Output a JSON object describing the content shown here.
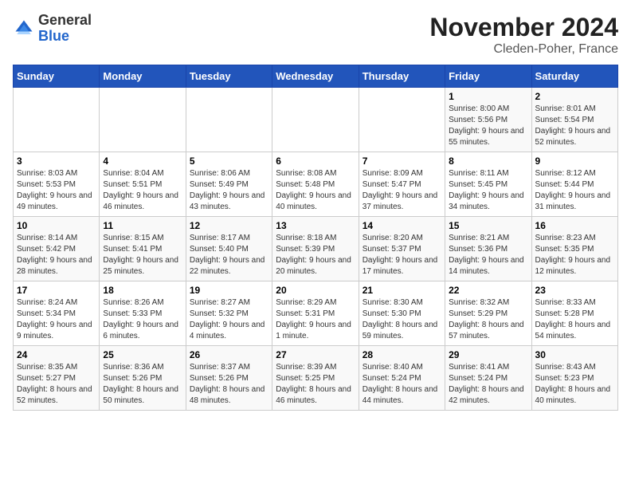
{
  "header": {
    "logo_line1": "General",
    "logo_line2": "Blue",
    "title": "November 2024",
    "subtitle": "Cleden-Poher, France"
  },
  "calendar": {
    "weekdays": [
      "Sunday",
      "Monday",
      "Tuesday",
      "Wednesday",
      "Thursday",
      "Friday",
      "Saturday"
    ],
    "weeks": [
      [
        {
          "day": "",
          "info": ""
        },
        {
          "day": "",
          "info": ""
        },
        {
          "day": "",
          "info": ""
        },
        {
          "day": "",
          "info": ""
        },
        {
          "day": "",
          "info": ""
        },
        {
          "day": "1",
          "info": "Sunrise: 8:00 AM\nSunset: 5:56 PM\nDaylight: 9 hours and 55 minutes."
        },
        {
          "day": "2",
          "info": "Sunrise: 8:01 AM\nSunset: 5:54 PM\nDaylight: 9 hours and 52 minutes."
        }
      ],
      [
        {
          "day": "3",
          "info": "Sunrise: 8:03 AM\nSunset: 5:53 PM\nDaylight: 9 hours and 49 minutes."
        },
        {
          "day": "4",
          "info": "Sunrise: 8:04 AM\nSunset: 5:51 PM\nDaylight: 9 hours and 46 minutes."
        },
        {
          "day": "5",
          "info": "Sunrise: 8:06 AM\nSunset: 5:49 PM\nDaylight: 9 hours and 43 minutes."
        },
        {
          "day": "6",
          "info": "Sunrise: 8:08 AM\nSunset: 5:48 PM\nDaylight: 9 hours and 40 minutes."
        },
        {
          "day": "7",
          "info": "Sunrise: 8:09 AM\nSunset: 5:47 PM\nDaylight: 9 hours and 37 minutes."
        },
        {
          "day": "8",
          "info": "Sunrise: 8:11 AM\nSunset: 5:45 PM\nDaylight: 9 hours and 34 minutes."
        },
        {
          "day": "9",
          "info": "Sunrise: 8:12 AM\nSunset: 5:44 PM\nDaylight: 9 hours and 31 minutes."
        }
      ],
      [
        {
          "day": "10",
          "info": "Sunrise: 8:14 AM\nSunset: 5:42 PM\nDaylight: 9 hours and 28 minutes."
        },
        {
          "day": "11",
          "info": "Sunrise: 8:15 AM\nSunset: 5:41 PM\nDaylight: 9 hours and 25 minutes."
        },
        {
          "day": "12",
          "info": "Sunrise: 8:17 AM\nSunset: 5:40 PM\nDaylight: 9 hours and 22 minutes."
        },
        {
          "day": "13",
          "info": "Sunrise: 8:18 AM\nSunset: 5:39 PM\nDaylight: 9 hours and 20 minutes."
        },
        {
          "day": "14",
          "info": "Sunrise: 8:20 AM\nSunset: 5:37 PM\nDaylight: 9 hours and 17 minutes."
        },
        {
          "day": "15",
          "info": "Sunrise: 8:21 AM\nSunset: 5:36 PM\nDaylight: 9 hours and 14 minutes."
        },
        {
          "day": "16",
          "info": "Sunrise: 8:23 AM\nSunset: 5:35 PM\nDaylight: 9 hours and 12 minutes."
        }
      ],
      [
        {
          "day": "17",
          "info": "Sunrise: 8:24 AM\nSunset: 5:34 PM\nDaylight: 9 hours and 9 minutes."
        },
        {
          "day": "18",
          "info": "Sunrise: 8:26 AM\nSunset: 5:33 PM\nDaylight: 9 hours and 6 minutes."
        },
        {
          "day": "19",
          "info": "Sunrise: 8:27 AM\nSunset: 5:32 PM\nDaylight: 9 hours and 4 minutes."
        },
        {
          "day": "20",
          "info": "Sunrise: 8:29 AM\nSunset: 5:31 PM\nDaylight: 9 hours and 1 minute."
        },
        {
          "day": "21",
          "info": "Sunrise: 8:30 AM\nSunset: 5:30 PM\nDaylight: 8 hours and 59 minutes."
        },
        {
          "day": "22",
          "info": "Sunrise: 8:32 AM\nSunset: 5:29 PM\nDaylight: 8 hours and 57 minutes."
        },
        {
          "day": "23",
          "info": "Sunrise: 8:33 AM\nSunset: 5:28 PM\nDaylight: 8 hours and 54 minutes."
        }
      ],
      [
        {
          "day": "24",
          "info": "Sunrise: 8:35 AM\nSunset: 5:27 PM\nDaylight: 8 hours and 52 minutes."
        },
        {
          "day": "25",
          "info": "Sunrise: 8:36 AM\nSunset: 5:26 PM\nDaylight: 8 hours and 50 minutes."
        },
        {
          "day": "26",
          "info": "Sunrise: 8:37 AM\nSunset: 5:26 PM\nDaylight: 8 hours and 48 minutes."
        },
        {
          "day": "27",
          "info": "Sunrise: 8:39 AM\nSunset: 5:25 PM\nDaylight: 8 hours and 46 minutes."
        },
        {
          "day": "28",
          "info": "Sunrise: 8:40 AM\nSunset: 5:24 PM\nDaylight: 8 hours and 44 minutes."
        },
        {
          "day": "29",
          "info": "Sunrise: 8:41 AM\nSunset: 5:24 PM\nDaylight: 8 hours and 42 minutes."
        },
        {
          "day": "30",
          "info": "Sunrise: 8:43 AM\nSunset: 5:23 PM\nDaylight: 8 hours and 40 minutes."
        }
      ]
    ]
  }
}
